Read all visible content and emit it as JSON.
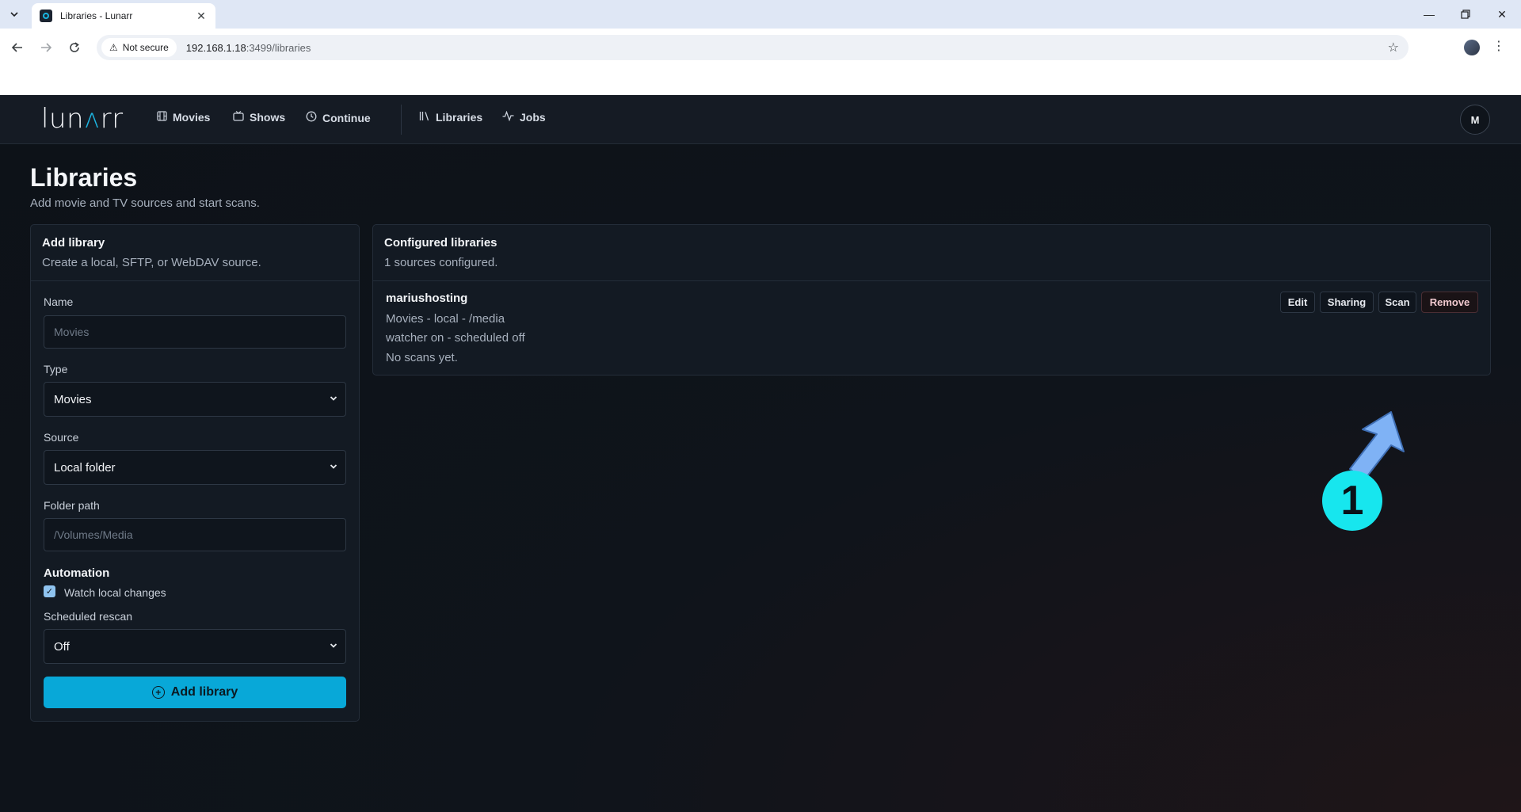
{
  "browser": {
    "tab_title": "Libraries - Lunarr",
    "security_label": "Not secure",
    "url_host": "192.168.1.18",
    "url_path": ":3499/libraries"
  },
  "app": {
    "logo_prefix": "lun",
    "logo_accent": "ʌ",
    "logo_suffix": "rr",
    "nav": {
      "movies": "Movies",
      "shows": "Shows",
      "continue": "Continue",
      "libraries": "Libraries",
      "jobs": "Jobs"
    },
    "avatar_initial": "M"
  },
  "page": {
    "title": "Libraries",
    "subtitle": "Add movie and TV sources and start scans."
  },
  "add_library": {
    "title": "Add library",
    "description": "Create a local, SFTP, or WebDAV source.",
    "name_label": "Name",
    "name_placeholder": "Movies",
    "type_label": "Type",
    "type_value": "Movies",
    "source_label": "Source",
    "source_value": "Local folder",
    "folder_label": "Folder path",
    "folder_placeholder": "/Volumes/Media",
    "automation_title": "Automation",
    "watch_label": "Watch local changes",
    "watch_checked": true,
    "rescan_label": "Scheduled rescan",
    "rescan_value": "Off",
    "submit_label": "Add library"
  },
  "configured": {
    "title": "Configured libraries",
    "count_text": "1 sources configured.",
    "libraries": [
      {
        "name": "mariushosting",
        "details": "Movies - local - /media",
        "status": "watcher on - scheduled off",
        "scans": "No scans yet.",
        "actions": {
          "edit": "Edit",
          "sharing": "Sharing",
          "scan": "Scan",
          "remove": "Remove"
        }
      }
    ]
  },
  "callout": {
    "number": "1",
    "color": "#17e6ee",
    "arrow_color": "#7fb2f5"
  },
  "colors": {
    "accent": "#08a8d8",
    "background": "#0d1117",
    "panel": "#131a23"
  }
}
